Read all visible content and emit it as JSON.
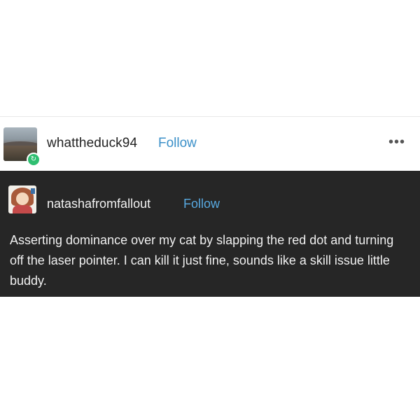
{
  "reblogger": {
    "username": "whattheduck94",
    "follow_label": "Follow",
    "avatar_icon": "landscape-avatar",
    "badge_icon": "reblog-icon",
    "more_label": "•••"
  },
  "post": {
    "author": "natashafromfallout",
    "follow_label": "Follow",
    "avatar_icon": "cartoon-girl-avatar",
    "text": "Asserting dominance over my cat by slapping the red dot and turning off the laser pointer. I can kill it just fine, sounds like a skill issue little buddy."
  },
  "colors": {
    "follow_blue_light": "#3a8fc8",
    "follow_blue_dark": "#58a9e0",
    "post_background": "#262626",
    "reblog_badge_green": "#2fbf71"
  }
}
